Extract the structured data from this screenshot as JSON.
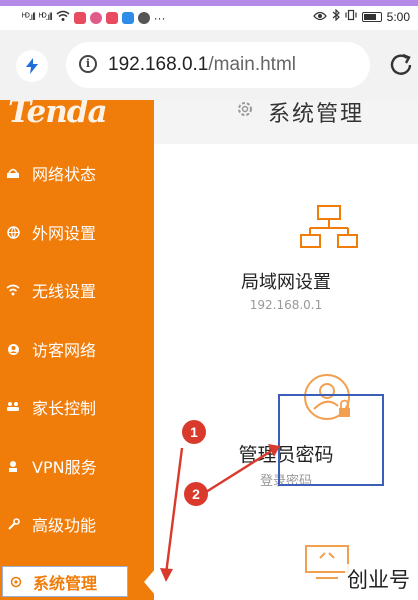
{
  "status_bar": {
    "signal_1": "ᴴᴰ.ıll",
    "signal_2": "ᴴᴰ.ıll",
    "overflow": "···",
    "time": "5:00",
    "battery_level": 0.85
  },
  "browser": {
    "url_host": "192.168.0.1",
    "url_path": "/main.html"
  },
  "sidebar": {
    "logo": "Tenda",
    "items": [
      {
        "label": "网络状态",
        "icon": "network-status-icon"
      },
      {
        "label": "外网设置",
        "icon": "globe-icon"
      },
      {
        "label": "无线设置",
        "icon": "wifi-icon"
      },
      {
        "label": "访客网络",
        "icon": "guest-icon"
      },
      {
        "label": "家长控制",
        "icon": "parental-icon"
      },
      {
        "label": "VPN服务",
        "icon": "vpn-icon"
      },
      {
        "label": "高级功能",
        "icon": "wrench-icon"
      },
      {
        "label": "系统管理",
        "icon": "system-icon",
        "active": true
      }
    ]
  },
  "main": {
    "title": "系统管理",
    "cards": [
      {
        "title": "局域网设置",
        "subtitle": "192.168.0.1",
        "icon": "lan-icon"
      },
      {
        "title": "管理员密码",
        "subtitle": "登录密码",
        "icon": "admin-lock-icon"
      },
      {
        "title": "",
        "subtitle": "",
        "icon": "screen-icon"
      }
    ]
  },
  "annotations": {
    "step_1": "1",
    "step_2": "2",
    "color": "#d93a2b"
  },
  "watermark": "创业号",
  "colors": {
    "accent": "#f07c0a",
    "highlight": "#3b5eb8"
  }
}
